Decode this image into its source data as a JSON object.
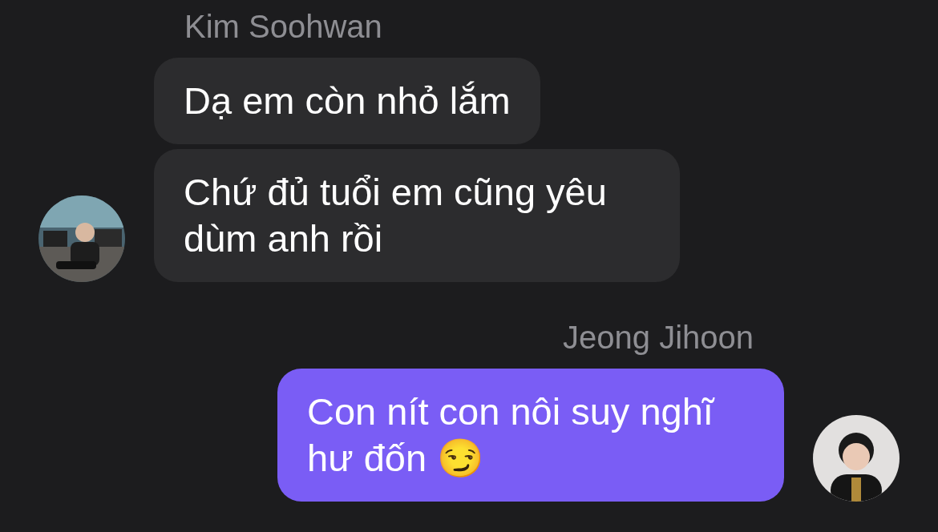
{
  "groups": [
    {
      "from_me": false,
      "sender": "Kim Soohwan",
      "avatar": {
        "kind": "picture"
      },
      "messages": [
        "Dạ em còn nhỏ lắm",
        "Chứ đủ tuổi em cũng yêu dùm anh rồi"
      ]
    },
    {
      "from_me": true,
      "sender": "Jeong Jihoon",
      "avatar": {
        "kind": "picture"
      },
      "messages": [
        "Con nít con nôi suy nghĩ hư đốn 😏"
      ]
    }
  ]
}
